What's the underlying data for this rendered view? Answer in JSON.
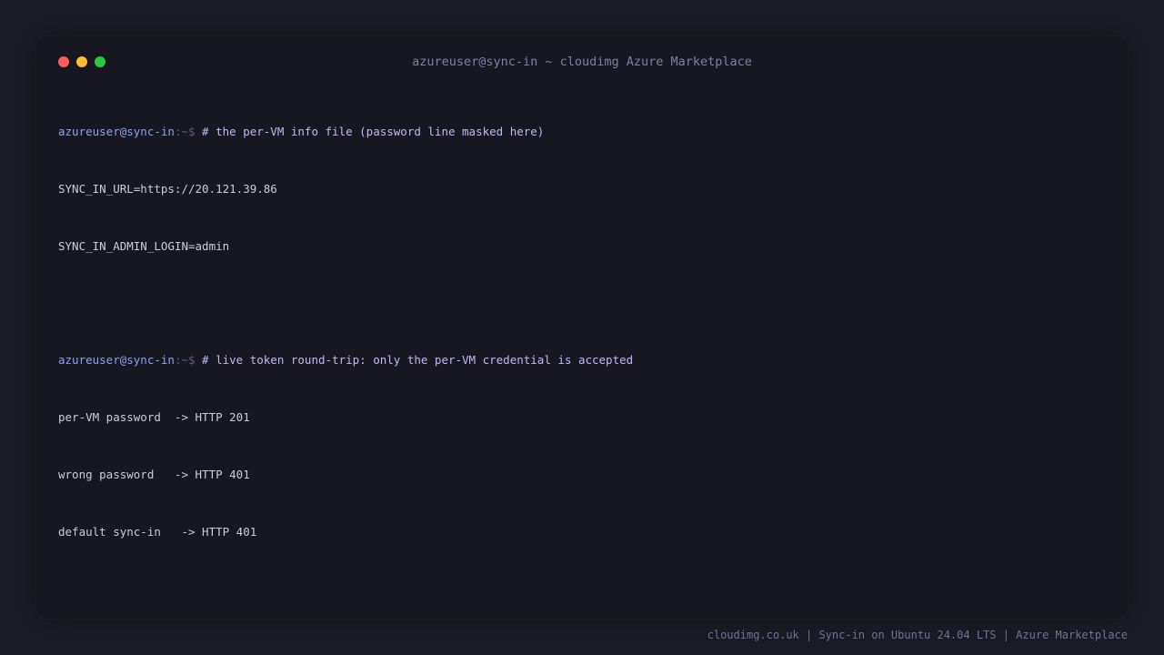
{
  "window": {
    "title": "azureuser@sync-in ~ cloudimg Azure Marketplace",
    "controls": {
      "close_color": "#ff5f57",
      "minimize_color": "#febc2e",
      "maximize_color": "#28c840"
    }
  },
  "terminal": {
    "blocks": [
      {
        "prompt_user": "azureuser@sync-in",
        "prompt_path": ":~$",
        "command": "# the per-VM info file (password line masked here)",
        "output": [
          "SYNC_IN_URL=https://20.121.39.86",
          "SYNC_IN_ADMIN_LOGIN=admin"
        ]
      },
      {
        "prompt_user": "azureuser@sync-in",
        "prompt_path": ":~$",
        "command": "# live token round-trip: only the per-VM credential is accepted",
        "output": [
          "per-VM password  -> HTTP 201",
          "wrong password   -> HTTP 401",
          "default sync-in   -> HTTP 401"
        ]
      }
    ]
  },
  "footer": {
    "text": "cloudimg.co.uk | Sync-in on Ubuntu 24.04 LTS | Azure Marketplace"
  }
}
